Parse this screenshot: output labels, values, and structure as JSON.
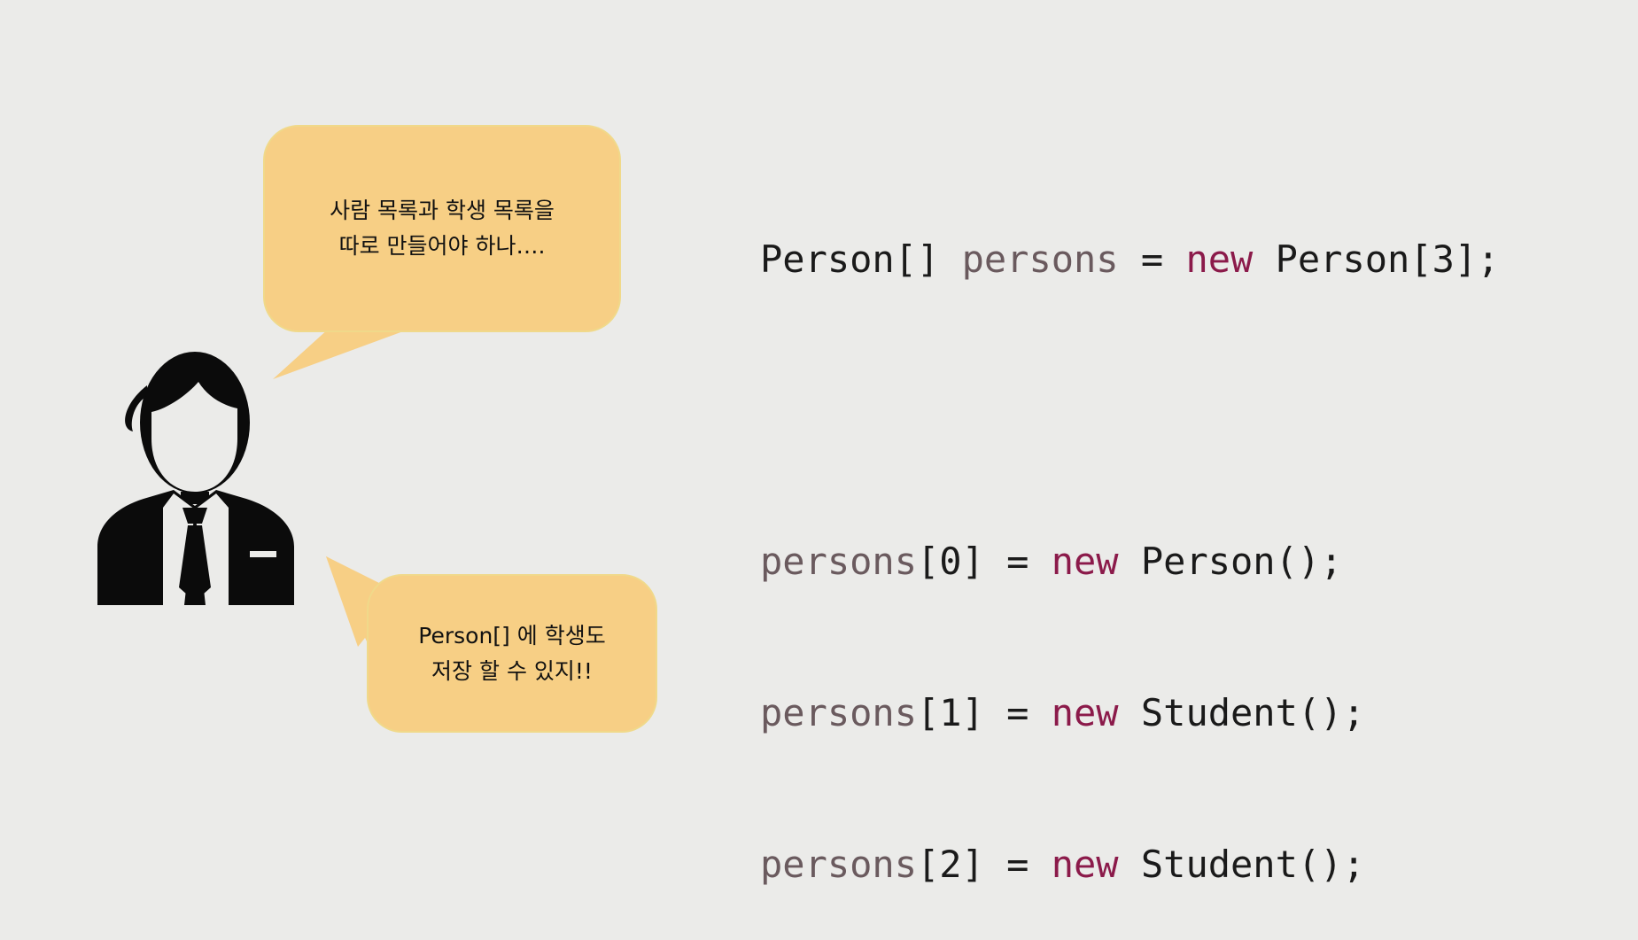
{
  "bubbles": {
    "top_text": "사람 목록과 학생 목록을\n따로 만들어야 하나….",
    "bottom_text": "Person[] 에 학생도\n저장 할 수 있지!!"
  },
  "code": {
    "line1": [
      {
        "text": "Person[]",
        "kind": "type"
      },
      {
        "text": " ",
        "kind": "punct"
      },
      {
        "text": "persons",
        "kind": "var"
      },
      {
        "text": " = ",
        "kind": "punct"
      },
      {
        "text": "new",
        "kind": "kw"
      },
      {
        "text": " Person[3];",
        "kind": "type"
      }
    ],
    "line2": [
      {
        "text": "persons",
        "kind": "var"
      },
      {
        "text": "[0] = ",
        "kind": "punct"
      },
      {
        "text": "new",
        "kind": "kw"
      },
      {
        "text": " Person();",
        "kind": "type"
      }
    ],
    "line3": [
      {
        "text": "persons",
        "kind": "var"
      },
      {
        "text": "[1] = ",
        "kind": "punct"
      },
      {
        "text": "new",
        "kind": "kw"
      },
      {
        "text": " Student();",
        "kind": "type"
      }
    ],
    "line4": [
      {
        "text": "persons",
        "kind": "var"
      },
      {
        "text": "[2] = ",
        "kind": "punct"
      },
      {
        "text": "new",
        "kind": "kw"
      },
      {
        "text": " Student();",
        "kind": "type"
      }
    ]
  },
  "colors": {
    "background": "#ebebe9",
    "bubble": "#f7cf85",
    "keyword": "#8b1a4a",
    "variable": "#6a5a5e",
    "text": "#1a1a1a"
  },
  "icons": {
    "person": "businessman-icon"
  }
}
